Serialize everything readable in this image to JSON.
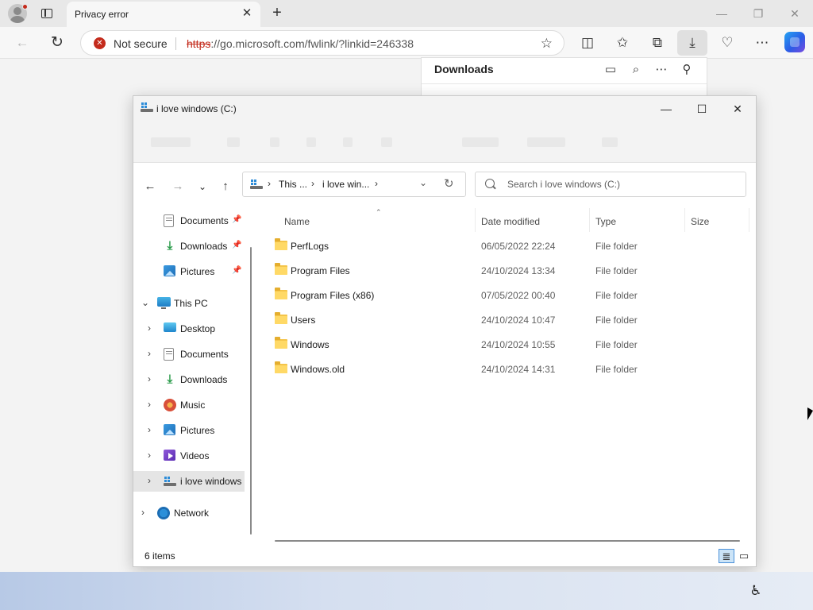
{
  "browser": {
    "tab_title": "Privacy error",
    "tab_close": "✕",
    "new_tab": "+",
    "security_label": "Not secure",
    "url_scheme": "https",
    "url_rest": "://go.microsoft.com/fwlink/?linkid=246338",
    "icons": [
      "profile-icon",
      "tab-actions-icon",
      "back-icon",
      "reload-icon",
      "favorite-star-icon",
      "split-screen-icon",
      "favorites-icon",
      "collections-icon",
      "downloads-icon",
      "browser-essentials-icon",
      "more-icon",
      "copilot-icon"
    ]
  },
  "downloads_panel": {
    "title": "Downloads"
  },
  "explorer": {
    "title": "i love windows (C:)",
    "breadcrumbs": [
      "This ...",
      "i love win..."
    ],
    "search_placeholder": "Search i love windows (C:)",
    "sidebar": {
      "quick": [
        {
          "label": "Documents",
          "icon": "documents-icon",
          "pinned": true
        },
        {
          "label": "Downloads",
          "icon": "downloads-icon",
          "pinned": true
        },
        {
          "label": "Pictures",
          "icon": "pictures-icon",
          "pinned": true
        }
      ],
      "this_pc": "This PC",
      "pc_items": [
        {
          "label": "Desktop",
          "icon": "desktop-icon"
        },
        {
          "label": "Documents",
          "icon": "documents-icon"
        },
        {
          "label": "Downloads",
          "icon": "downloads-icon"
        },
        {
          "label": "Music",
          "icon": "music-icon"
        },
        {
          "label": "Pictures",
          "icon": "pictures-icon"
        },
        {
          "label": "Videos",
          "icon": "videos-icon"
        },
        {
          "label": "i love windows",
          "icon": "drive-icon",
          "selected": true
        }
      ],
      "network": "Network"
    },
    "columns": {
      "name": "Name",
      "date": "Date modified",
      "type": "Type",
      "size": "Size"
    },
    "files": [
      {
        "name": "PerfLogs",
        "date": "06/05/2022 22:24",
        "type": "File folder"
      },
      {
        "name": "Program Files",
        "date": "24/10/2024 13:34",
        "type": "File folder"
      },
      {
        "name": "Program Files (x86)",
        "date": "07/05/2022 00:40",
        "type": "File folder"
      },
      {
        "name": "Users",
        "date": "24/10/2024 10:47",
        "type": "File folder"
      },
      {
        "name": "Windows",
        "date": "24/10/2024 10:55",
        "type": "File folder"
      },
      {
        "name": "Windows.old",
        "date": "24/10/2024 14:31",
        "type": "File folder"
      }
    ],
    "status": "6 items"
  },
  "colors": {
    "accent": "#0067c0",
    "danger": "#c42b1c",
    "folder": "#ffd966"
  }
}
